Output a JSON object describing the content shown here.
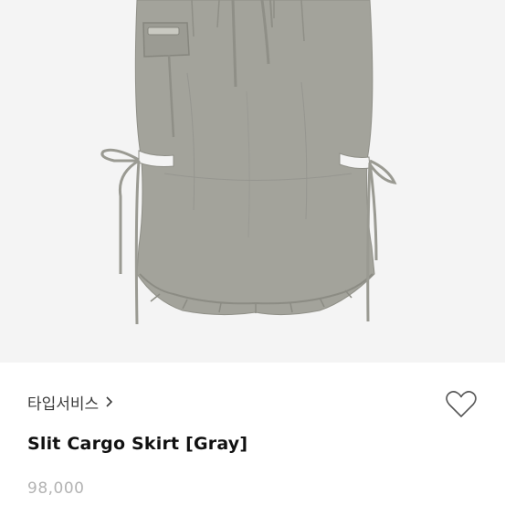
{
  "product": {
    "image_label": "skirt-photo",
    "brand": "타입서비스",
    "name": "Slit Cargo Skirt [Gray]",
    "price": "98,000"
  },
  "icons": {
    "brand_chevron": "chevron-right-icon",
    "like": "heart-outline-icon"
  },
  "colors": {
    "image_background": "#f4f4f4",
    "skirt": "#a3a39b",
    "price_text": "#b3b3b3"
  }
}
